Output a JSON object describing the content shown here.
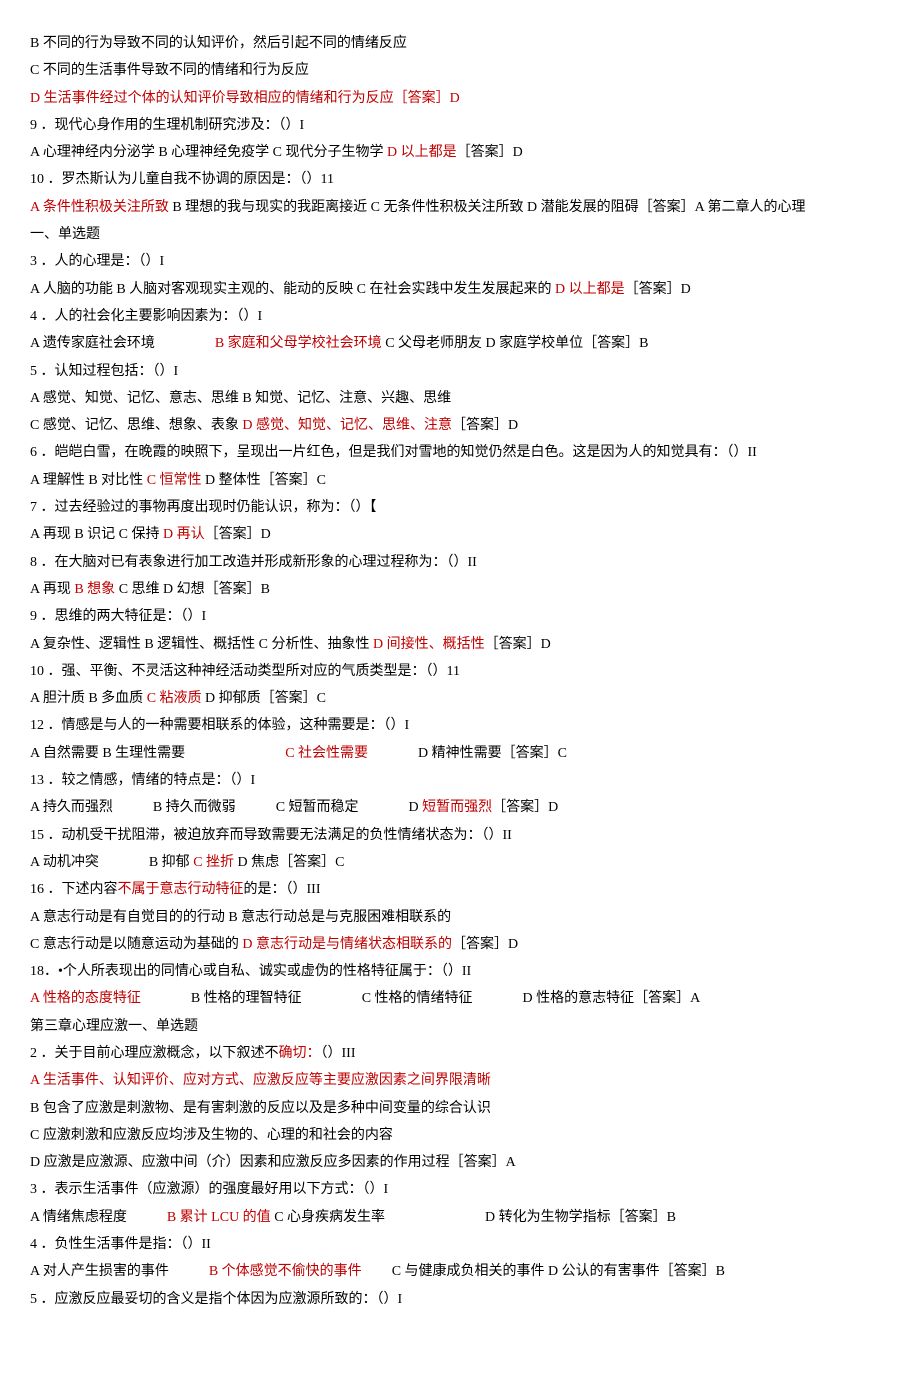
{
  "lines": [
    [
      {
        "t": "B 不同的行为导致不同的认知评价，然后引起不同的情绪反应",
        "c": "b"
      }
    ],
    [
      {
        "t": "C 不同的生活事件导致不同的情绪和行为反应",
        "c": "b"
      }
    ],
    [
      {
        "t": "D 生活事件经过个体的认知评价导致相应的情绪和行为反应［答案］D",
        "c": "r"
      }
    ],
    [
      {
        "t": "9 ．现代心身作用的生理机制研究涉及：（）I",
        "c": "b"
      }
    ],
    [
      {
        "t": "A 心理神经内分泌学 B 心理神经免疫学 C 现代分子生物学 ",
        "c": "b"
      },
      {
        "t": "D 以上都是",
        "c": "r"
      },
      {
        "t": "［答案］D",
        "c": "b"
      }
    ],
    [
      {
        "t": "10 ．罗杰斯认为儿童自我不协调的原因是：（）11",
        "c": "b"
      }
    ],
    [
      {
        "t": "A 条件性积极关注所致 ",
        "c": "r"
      },
      {
        "t": "B 理想的我与现实的我距离接近 C 无条件性积极关注所致 D 潜能发展的阻碍［答案］A 第二章人的心理",
        "c": "b"
      }
    ],
    [
      {
        "t": "一、单选题",
        "c": "b"
      }
    ],
    [
      {
        "t": "3 ．人的心理是：（）I",
        "c": "b"
      }
    ],
    [
      {
        "t": "A 人脑的功能 B 人脑对客观现实主观的、能动的反映 C 在社会实践中发生发展起来的 ",
        "c": "b"
      },
      {
        "t": "D 以上都是",
        "c": "r"
      },
      {
        "t": "［答案］D",
        "c": "b"
      }
    ],
    [
      {
        "t": "4 ．人的社会化主要影响因素为：（）I",
        "c": "b"
      }
    ],
    [
      {
        "t": "A 遗传家庭社会环境",
        "c": "b"
      },
      {
        "gap": 60
      },
      {
        "t": "B 家庭和父母学校社会环境 ",
        "c": "r"
      },
      {
        "t": "C 父母老师朋友 D 家庭学校单位［答案］B",
        "c": "b"
      }
    ],
    [
      {
        "t": "5 ．认知过程包括：（）I",
        "c": "b"
      }
    ],
    [
      {
        "t": "A 感觉、知觉、记忆、意志、思维 B 知觉、记忆、注意、兴趣、思维",
        "c": "b"
      }
    ],
    [
      {
        "t": "C 感觉、记忆、思维、想象、表象 ",
        "c": "b"
      },
      {
        "t": "D 感觉、知觉、记忆、思维、注意",
        "c": "r"
      },
      {
        "t": "［答案］D",
        "c": "b"
      }
    ],
    [
      {
        "t": "6 ．皑皑白雪，在晚霞的映照下，呈现出一片红色，但是我们对雪地的知觉仍然是白色。这是因为人的知觉具有：（）II",
        "c": "b"
      }
    ],
    [
      {
        "t": "A 理解性 B 对比性 ",
        "c": "b"
      },
      {
        "t": "C 恒常性 ",
        "c": "r"
      },
      {
        "t": "D 整体性［答案］C",
        "c": "b"
      }
    ],
    [
      {
        "t": "7 ．过去经验过的事物再度出现时仍能认识，称为：（）【",
        "c": "b"
      }
    ],
    [
      {
        "t": "A 再现 B 识记 C 保持 ",
        "c": "b"
      },
      {
        "t": "D 再认",
        "c": "r"
      },
      {
        "t": "［答案］D",
        "c": "b"
      }
    ],
    [
      {
        "t": "8 ．在大脑对已有表象进行加工改造并形成新形象的心理过程称为：（）II",
        "c": "b"
      }
    ],
    [
      {
        "t": "A 再现 ",
        "c": "b"
      },
      {
        "t": "B 想象 ",
        "c": "r"
      },
      {
        "t": "C 思维 D 幻想［答案］B",
        "c": "b"
      }
    ],
    [
      {
        "t": "9 ．思维的两大特征是：（）I",
        "c": "b"
      }
    ],
    [
      {
        "t": "A 复杂性、逻辑性 B 逻辑性、概括性 C 分析性、抽象性 ",
        "c": "b"
      },
      {
        "t": "D 间接性、概括性",
        "c": "r"
      },
      {
        "t": "［答案］D",
        "c": "b"
      }
    ],
    [
      {
        "t": "10 ．强、平衡、不灵活这种神经活动类型所对应的气质类型是：（）11",
        "c": "b"
      }
    ],
    [
      {
        "t": "A 胆汁质 B 多血质 ",
        "c": "b"
      },
      {
        "t": "C 粘液质 ",
        "c": "r"
      },
      {
        "t": "D 抑郁质［答案］C",
        "c": "b"
      }
    ],
    [
      {
        "t": "12 ．情感是与人的一种需要相联系的体验，这种需要是：（）I",
        "c": "b"
      }
    ],
    [
      {
        "t": "A 自然需要 B 生理性需要",
        "c": "b"
      },
      {
        "gap": 100
      },
      {
        "t": "C 社会性需要",
        "c": "r"
      },
      {
        "gap": 50
      },
      {
        "t": "D 精神性需要［答案］C",
        "c": "b"
      }
    ],
    [
      {
        "t": "13 ．较之情感，情绪的特点是：（）I",
        "c": "b"
      }
    ],
    [
      {
        "t": "A 持久而强烈",
        "c": "b"
      },
      {
        "gap": 40
      },
      {
        "t": "B 持久而微弱",
        "c": "b"
      },
      {
        "gap": 40
      },
      {
        "t": "C 短暂而稳定",
        "c": "b"
      },
      {
        "gap": 50
      },
      {
        "t": "D ",
        "c": "b"
      },
      {
        "t": "短暂而强烈",
        "c": "r"
      },
      {
        "t": "［答案］D",
        "c": "b"
      }
    ],
    [
      {
        "t": "15 ．动机受干扰阻滞，被迫放弃而导致需要无法满足的负性情绪状态为：（）II",
        "c": "b"
      }
    ],
    [
      {
        "t": "A 动机冲突",
        "c": "b"
      },
      {
        "gap": 50
      },
      {
        "t": "B 抑郁 ",
        "c": "b"
      },
      {
        "t": "C 挫折 ",
        "c": "r"
      },
      {
        "t": "D 焦虑［答案］C",
        "c": "b"
      }
    ],
    [
      {
        "t": "16 ．下述内容",
        "c": "b"
      },
      {
        "t": "不属于意志行动特征",
        "c": "r"
      },
      {
        "t": "的是：（）III",
        "c": "b"
      }
    ],
    [
      {
        "t": "A 意志行动是有自觉目的的行动 B 意志行动总是与克服困难相联系的",
        "c": "b"
      }
    ],
    [
      {
        "t": "C 意志行动是以随意运动为基础的 ",
        "c": "b"
      },
      {
        "t": "D 意志行动是与情绪状态相联系的",
        "c": "r"
      },
      {
        "t": "［答案］D",
        "c": "b"
      }
    ],
    [
      {
        "t": "18．•个人所表现出的同情心或自私、诚实或虚伪的性格特征属于：（）II",
        "c": "b"
      }
    ],
    [
      {
        "t": "A 性格的态度特征",
        "c": "r"
      },
      {
        "gap": 50
      },
      {
        "t": "B 性格的理智特征",
        "c": "b"
      },
      {
        "gap": 60
      },
      {
        "t": "C 性格的情绪特征",
        "c": "b"
      },
      {
        "gap": 50
      },
      {
        "t": "D 性格的意志特征［答案］A",
        "c": "b"
      }
    ],
    [
      {
        "t": "第三章心理应激一、单选题",
        "c": "b"
      }
    ],
    [
      {
        "t": "2 ．关于目前心理应激概念，以下叙述不",
        "c": "b"
      },
      {
        "t": "确切：",
        "c": "r"
      },
      {
        "t": "（）III",
        "c": "b"
      }
    ],
    [
      {
        "t": "A 生活事件、认知评价、应对方式、应激反应等主要应激因素之间界限清晰",
        "c": "r"
      }
    ],
    [
      {
        "t": "B 包含了应激是刺激物、是有害刺激的反应以及是多种中间变量的综合认识",
        "c": "b"
      }
    ],
    [
      {
        "t": "C 应激刺激和应激反应均涉及生物的、心理的和社会的内容",
        "c": "b"
      }
    ],
    [
      {
        "t": "D 应激是应激源、应激中间（介）因素和应激反应多因素的作用过程［答案］A",
        "c": "b"
      }
    ],
    [
      {
        "t": "3 ．表示生活事件（应激源）的强度最好用以下方式：（）I",
        "c": "b"
      }
    ],
    [
      {
        "t": "A 情绪焦虑程度",
        "c": "b"
      },
      {
        "gap": 40
      },
      {
        "t": "B 累计 LCU 的值 ",
        "c": "r"
      },
      {
        "t": "C 心身疾病发生率",
        "c": "b"
      },
      {
        "gap": 100
      },
      {
        "t": "D 转化为生物学指标［答案］B",
        "c": "b"
      }
    ],
    [
      {
        "t": "4 ．负性生活事件是指：（）II",
        "c": "b"
      }
    ],
    [
      {
        "t": "A 对人产生损害的事件",
        "c": "b"
      },
      {
        "gap": 40
      },
      {
        "t": "B 个体感觉不偷快的事件",
        "c": "r"
      },
      {
        "gap": 30
      },
      {
        "t": "C 与健康成负相关的事件 D 公认的有害事件［答案］B",
        "c": "b"
      }
    ],
    [
      {
        "t": "5 ．应激反应最妥切的含义是指个体因为应激源所致的：（）I",
        "c": "b"
      }
    ]
  ]
}
